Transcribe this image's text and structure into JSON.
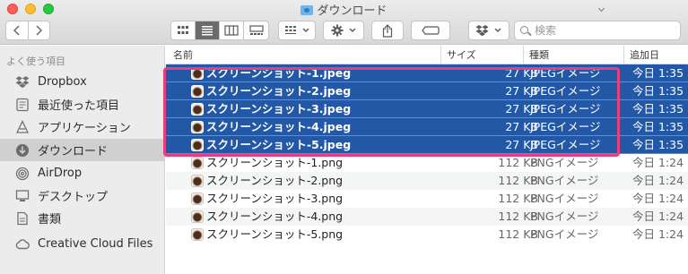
{
  "window": {
    "title": "ダウンロード"
  },
  "toolbar": {
    "back_icon": "chevron-left-icon",
    "forward_icon": "chevron-right-icon",
    "view_icons": [
      "icon-view-icon",
      "list-view-icon",
      "column-view-icon",
      "gallery-view-icon"
    ],
    "search_placeholder": "検索"
  },
  "sidebar": {
    "header": "よく使う項目",
    "items": [
      {
        "label": "Dropbox",
        "icon": "dropbox-icon"
      },
      {
        "label": "最近使った項目",
        "icon": "recents-icon"
      },
      {
        "label": "アプリケーション",
        "icon": "applications-icon"
      },
      {
        "label": "ダウンロード",
        "icon": "download-icon",
        "selected": true
      },
      {
        "label": "AirDrop",
        "icon": "airdrop-icon"
      },
      {
        "label": "デスクトップ",
        "icon": "desktop-icon"
      },
      {
        "label": "書類",
        "icon": "documents-icon"
      },
      {
        "label": "Creative Cloud Files",
        "icon": "creative-cloud-icon"
      }
    ]
  },
  "columns": {
    "name": "名前",
    "size": "サイズ",
    "kind": "種類",
    "date": "追加日"
  },
  "files": [
    {
      "name": "スクリーンショット-1.jpeg",
      "size": "27 KB",
      "kind": "JPEGイメージ",
      "date": "今日 1:35",
      "selected": true
    },
    {
      "name": "スクリーンショット-2.jpeg",
      "size": "27 KB",
      "kind": "JPEGイメージ",
      "date": "今日 1:35",
      "selected": true
    },
    {
      "name": "スクリーンショット-3.jpeg",
      "size": "27 KB",
      "kind": "JPEGイメージ",
      "date": "今日 1:35",
      "selected": true
    },
    {
      "name": "スクリーンショット-4.jpeg",
      "size": "27 KB",
      "kind": "JPEGイメージ",
      "date": "今日 1:35",
      "selected": true
    },
    {
      "name": "スクリーンショット-5.jpeg",
      "size": "27 KB",
      "kind": "JPEGイメージ",
      "date": "今日 1:35",
      "selected": true
    },
    {
      "name": "スクリーンショット-1.png",
      "size": "112 KB",
      "kind": "PNGイメージ",
      "date": "今日 1:24",
      "selected": false
    },
    {
      "name": "スクリーンショット-2.png",
      "size": "112 KB",
      "kind": "PNGイメージ",
      "date": "今日 1:24",
      "selected": false
    },
    {
      "name": "スクリーンショット-3.png",
      "size": "112 KB",
      "kind": "PNGイメージ",
      "date": "今日 1:24",
      "selected": false
    },
    {
      "name": "スクリーンショット-4.png",
      "size": "112 KB",
      "kind": "PNGイメージ",
      "date": "今日 1:24",
      "selected": false
    },
    {
      "name": "スクリーンショット-5.png",
      "size": "112 KB",
      "kind": "PNGイメージ",
      "date": "今日 1:24",
      "selected": false
    }
  ],
  "colors": {
    "selection": "#2358a7",
    "highlight_frame": "#e83d7f",
    "sidebar_bg": "#ececec"
  }
}
